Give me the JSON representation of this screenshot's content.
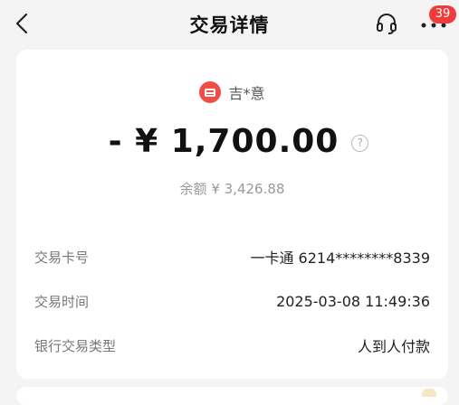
{
  "nav": {
    "title": "交易详情",
    "badge_count": "39"
  },
  "transaction": {
    "merchant": "吉*意",
    "amount": "- ¥ 1,700.00",
    "help_symbol": "?",
    "balance": "余额 ¥ 3,426.88"
  },
  "details": [
    {
      "label": "交易卡号",
      "value": "一卡通 6214********8339"
    },
    {
      "label": "交易时间",
      "value": "2025-03-08 11:49:36"
    },
    {
      "label": "银行交易类型",
      "value": "人到人付款"
    }
  ],
  "colors": {
    "accent": "#ef4e47",
    "badge": "#ef3b3b"
  }
}
